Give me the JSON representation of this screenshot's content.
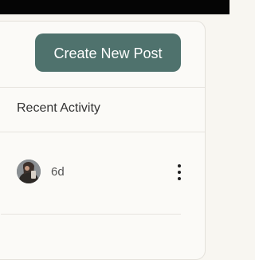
{
  "header": {
    "create_button_label": "Create New Post"
  },
  "section": {
    "title": "Recent Activity"
  },
  "activity": {
    "items": [
      {
        "avatar": "user-avatar",
        "time": "6d",
        "menu_icon": "more-vertical-icon"
      }
    ]
  },
  "colors": {
    "accent": "#4f726d",
    "background": "#f8f6f1",
    "card": "#fbfaf7",
    "border": "#e4e1db",
    "text": "#333333"
  }
}
